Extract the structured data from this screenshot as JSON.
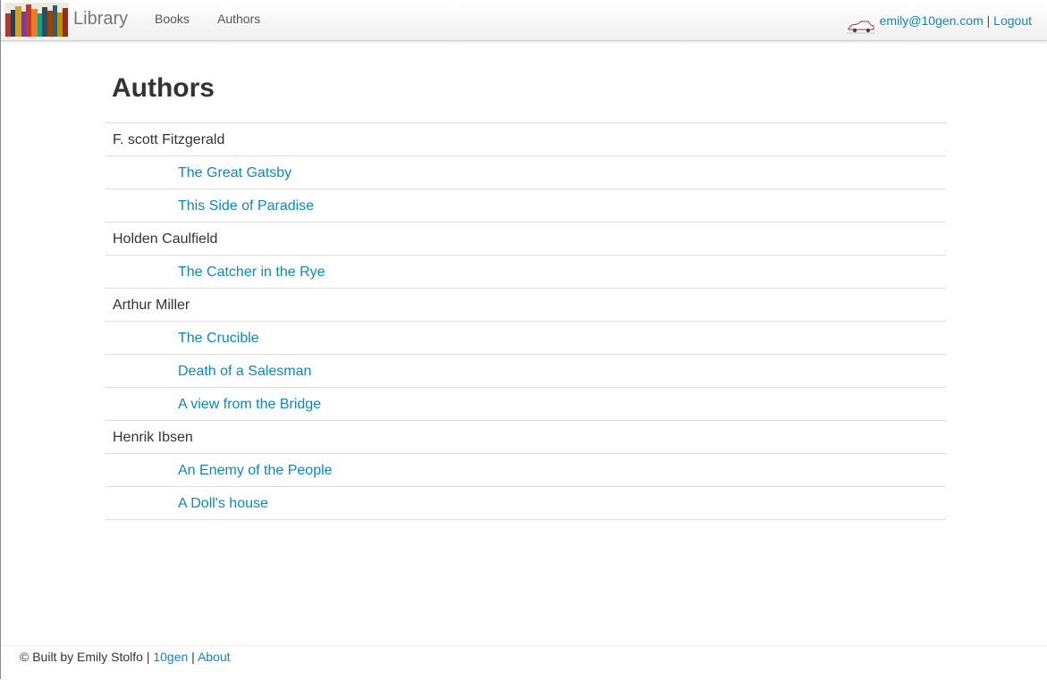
{
  "navbar": {
    "brand": "Library",
    "links": [
      "Books",
      "Authors"
    ],
    "user_email": "emily@10gen.com",
    "separator": "|",
    "logout": "Logout",
    "logo_icon": "bookshelf-logo-icon",
    "avatar_icon": "car-avatar-icon"
  },
  "page": {
    "title": "Authors"
  },
  "authors": [
    {
      "name": "F. scott Fitzgerald",
      "books": [
        "The Great Gatsby",
        "This Side of Paradise"
      ]
    },
    {
      "name": "Holden Caulfield",
      "books": [
        "The Catcher in the Rye"
      ]
    },
    {
      "name": "Arthur Miller",
      "books": [
        "The Crucible",
        "Death of a Salesman",
        "A view from the Bridge"
      ]
    },
    {
      "name": "Henrik Ibsen",
      "books": [
        "An Enemy of the People",
        "A Doll's house"
      ]
    }
  ],
  "footer": {
    "credit": "© Built by Emily Stolfo",
    "separator": "|",
    "link_10gen": "10gen",
    "link_about": "About"
  },
  "colors": {
    "link": "#0a88c6",
    "text": "#333333",
    "divider": "#dddddd"
  }
}
